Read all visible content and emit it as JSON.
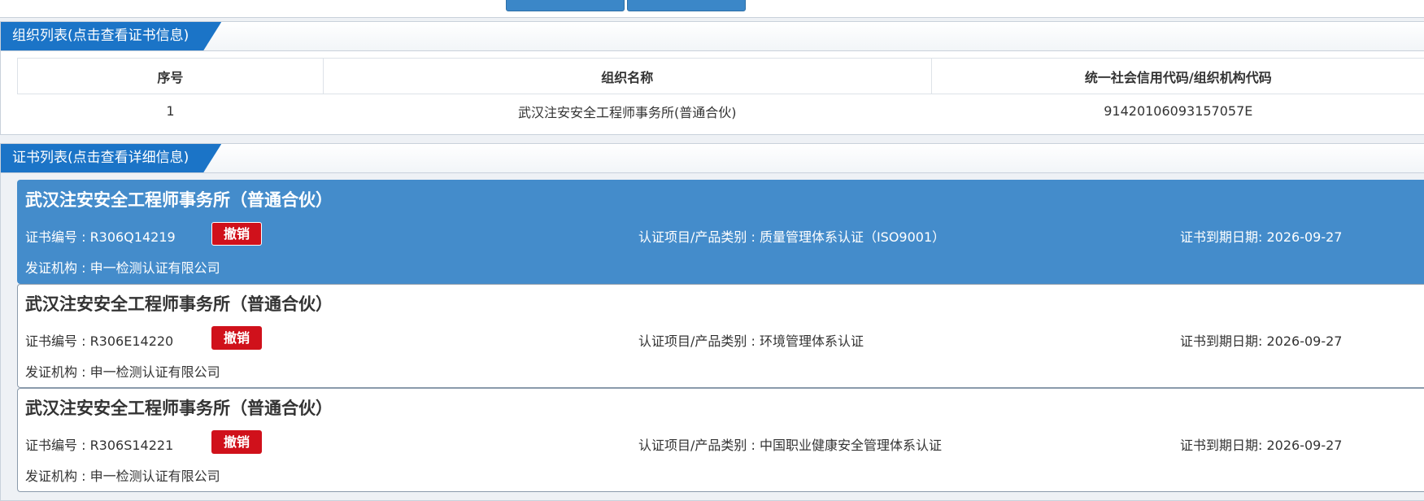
{
  "org_section": {
    "title": "组织列表(点击查看证书信息)",
    "columns": [
      "序号",
      "组织名称",
      "统一社会信用代码/组织机构代码"
    ],
    "rows": [
      {
        "index": "1",
        "name": "武汉注安安全工程师事务所(普通合伙)",
        "code": "91420106093157057E"
      }
    ]
  },
  "cert_section": {
    "title": "证书列表(点击查看详细信息)",
    "certificates": [
      {
        "org_name": "武汉注安安全工程师事务所（普通合伙）",
        "cert_no": "证书编号 : R306Q14219",
        "status": "撤销",
        "project": "认证项目/产品类别 : 质量管理体系认证（ISO9001）",
        "expiry": "证书到期日期: 2026-09-27",
        "issuer": "发证机构 : 申一检测认证有限公司",
        "selected": true
      },
      {
        "org_name": "武汉注安安全工程师事务所（普通合伙）",
        "cert_no": "证书编号 : R306E14220",
        "status": "撤销",
        "project": "认证项目/产品类别 : 环境管理体系认证",
        "expiry": "证书到期日期: 2026-09-27",
        "issuer": "发证机构 : 申一检测认证有限公司",
        "selected": false
      },
      {
        "org_name": "武汉注安安全工程师事务所（普通合伙）",
        "cert_no": "证书编号 : R306S14221",
        "status": "撤销",
        "project": "认证项目/产品类别 : 中国职业健康安全管理体系认证",
        "expiry": "证书到期日期: 2026-09-27",
        "issuer": "发证机构 : 申一检测认证有限公司",
        "selected": false
      }
    ]
  },
  "colors": {
    "tab_blue": "#1b74c7",
    "selected_card": "#448ccb",
    "revoked_badge": "#d0111b"
  }
}
